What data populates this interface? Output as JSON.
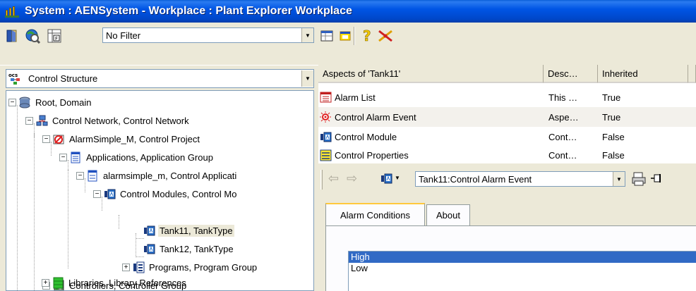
{
  "window": {
    "title": "System : AENSystem - Workplace : Plant Explorer Workplace"
  },
  "toolbar": {
    "filter_value": "No Filter"
  },
  "structure_selector": {
    "value": "Control Structure"
  },
  "tree": {
    "items": [
      {
        "label": "Root, Domain",
        "expander": "−",
        "icon": "database-icon"
      },
      {
        "label": "Control Network, Control Network",
        "expander": "−",
        "icon": "network-icon"
      },
      {
        "label": "AlarmSimple_M, Control Project",
        "expander": "−",
        "icon": "control-project-icon"
      },
      {
        "label": "Applications, Application Group",
        "expander": "−",
        "icon": "application-group-icon"
      },
      {
        "label": "alarmsimple_m, Control Applicati",
        "expander": "−",
        "icon": "application-icon"
      },
      {
        "label": "Control Modules, Control Mo",
        "expander": "−",
        "icon": "control-modules-icon"
      },
      {
        "label": "Tank11, TankType",
        "expander": "",
        "icon": "control-module-icon"
      },
      {
        "label": "Tank12, TankType",
        "expander": "",
        "icon": "control-module-icon"
      },
      {
        "label": "Programs, Program Group",
        "expander": "+",
        "icon": "program-group-icon"
      },
      {
        "label": "Controllers, Controller Group",
        "expander": "+",
        "icon": "controller-group-icon"
      },
      {
        "label": "Libraries, Library References",
        "expander": "+",
        "icon": "library-icon"
      }
    ]
  },
  "aspects": {
    "columns": [
      "Aspects of 'Tank11'",
      "Desc…",
      "Inherited"
    ],
    "rows": [
      {
        "name": "Alarm List",
        "desc": "This …",
        "inherited": "True",
        "icon": "alarm-list-icon"
      },
      {
        "name": "Control Alarm Event",
        "desc": "Aspe…",
        "inherited": "True",
        "icon": "alarm-event-icon"
      },
      {
        "name": "Control Module",
        "desc": "Cont…",
        "inherited": "False",
        "icon": "control-module-icon"
      },
      {
        "name": "Control Properties",
        "desc": "Cont…",
        "inherited": "False",
        "icon": "properties-icon"
      }
    ]
  },
  "aspect_view": {
    "selected_aspect": "Tank11:Control Alarm Event",
    "tabs": [
      "Alarm Conditions",
      "About"
    ],
    "conditions": [
      {
        "label": "High",
        "selected": true
      },
      {
        "label": "Low",
        "selected": false
      }
    ]
  },
  "colors": {
    "title_bar": "#0055e5",
    "selection": "#316ac5",
    "tab_highlight": "#ffc83c"
  }
}
